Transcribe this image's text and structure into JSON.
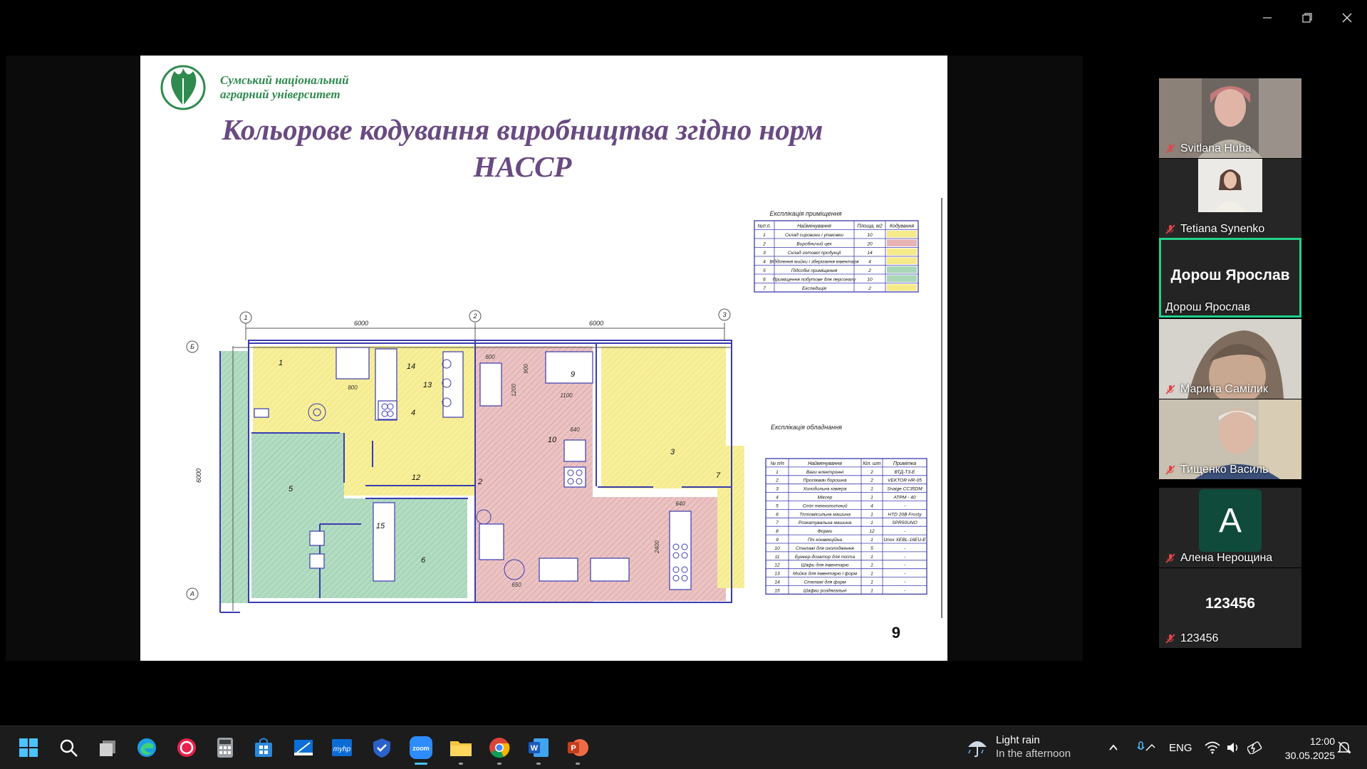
{
  "window": {
    "minimize_label": "minimize",
    "restore_label": "restore",
    "close_label": "close"
  },
  "slide": {
    "university_line1": "Сумський національний",
    "university_line2": "аграрний університет",
    "title_line1": "Кольорове кодування виробництва згідно норм",
    "title_line2": "НАССР",
    "page_number": "9"
  },
  "plan": {
    "dimensions": [
      "6000",
      "6000",
      "6000"
    ],
    "axes": [
      "1",
      "2",
      "3",
      "Б",
      "А"
    ],
    "room_labels": [
      "1",
      "2",
      "3",
      "4",
      "5",
      "6",
      "7",
      "12",
      "14",
      "13",
      "15",
      "9",
      "10"
    ],
    "sizes": [
      "800",
      "600",
      "900",
      "1200",
      "1100",
      "640",
      "640",
      "2400",
      "650"
    ]
  },
  "rooms_table": {
    "title": "Експлікація приміщення",
    "headers": [
      "№п.п.",
      "Найменування",
      "Площа, м2",
      "Кодування"
    ],
    "rows": [
      {
        "n": "1",
        "name": "Склад сировини і упаковки",
        "area": "10",
        "color": "#f5ea8a"
      },
      {
        "n": "2",
        "name": "Виробничий цех",
        "area": "20",
        "color": "#e7b3b3"
      },
      {
        "n": "3",
        "name": "Склад готової продукції",
        "area": "14",
        "color": "#f5ea8a"
      },
      {
        "n": "4",
        "name": "Відділення мийки і зберігання інвентаря",
        "area": "4",
        "color": "#f5ea8a"
      },
      {
        "n": "5",
        "name": "Підсобні приміщення",
        "area": "2",
        "color": "#a9d7b8"
      },
      {
        "n": "6",
        "name": "Приміщення побутове для персоналу",
        "area": "10",
        "color": "#a9d7b8"
      },
      {
        "n": "7",
        "name": "Експедиція",
        "area": "2",
        "color": "#f5ea8a"
      }
    ]
  },
  "equipment_table": {
    "title": "Експлікація обладнання",
    "headers": [
      "№ п/п",
      "Найменування",
      "Кіл. шт",
      "Примітка"
    ],
    "rows": [
      {
        "n": "1",
        "name": "Ваги електронні",
        "q": "2",
        "note": "ВТД-Т3-Е"
      },
      {
        "n": "2",
        "name": "Просіювач борошна",
        "q": "2",
        "note": "VEKTOR HR-05"
      },
      {
        "n": "3",
        "name": "Холодильна камера",
        "q": "1",
        "note": "Snaige CC35DM"
      },
      {
        "n": "4",
        "name": "Міксер",
        "q": "1",
        "note": "ATPM - 40"
      },
      {
        "n": "5",
        "name": "Стіл технологічний",
        "q": "4",
        "note": "-"
      },
      {
        "n": "6",
        "name": "Тістомісильна машина",
        "q": "1",
        "note": "HTD 20B Frosty"
      },
      {
        "n": "7",
        "name": "Розкатувальна машина",
        "q": "1",
        "note": "SPR50UNO"
      },
      {
        "n": "8",
        "name": "Форми",
        "q": "12",
        "note": "-"
      },
      {
        "n": "9",
        "name": "Піч конвекційна",
        "q": "1",
        "note": "Unox XEBL-16EU-E"
      },
      {
        "n": "10",
        "name": "Стелажі для охолодження",
        "q": "5",
        "note": "-"
      },
      {
        "n": "11",
        "name": "Бункер-дозатор для тіста",
        "q": "1",
        "note": "-"
      },
      {
        "n": "12",
        "name": "Шафи для інвентарю",
        "q": "1",
        "note": "-"
      },
      {
        "n": "13",
        "name": "Мийка для інвентарю і форм",
        "q": "1",
        "note": "-"
      },
      {
        "n": "14",
        "name": "Стелажі для форм",
        "q": "1",
        "note": "-"
      },
      {
        "n": "15",
        "name": "Шафки роздягальні",
        "q": "1",
        "note": "-"
      }
    ]
  },
  "participants": [
    {
      "name": "Svitlana Huba",
      "type": "video"
    },
    {
      "name": "Tetiana Synenko",
      "type": "video"
    },
    {
      "name": "Дорош Ярослав",
      "type": "name",
      "big": "Дорош Ярослав"
    },
    {
      "name": "Марина Самілик",
      "type": "video"
    },
    {
      "name": "Тищенко Василь",
      "type": "video"
    },
    {
      "name": "Алена Нерощина",
      "type": "avatar",
      "letter": "A"
    },
    {
      "name": "123456",
      "type": "name",
      "big": "123456"
    }
  ],
  "taskbar": {
    "weather_title": "Light rain",
    "weather_sub": "In the afternoon",
    "language": "ENG",
    "time": "12:00",
    "date": "30.05.2025"
  },
  "colors": {
    "yellow": "#f5ea8a",
    "pink": "#e7b3b3",
    "green": "#a9d7b8",
    "active_border": "#23d18b",
    "title": "#6a4a82"
  }
}
